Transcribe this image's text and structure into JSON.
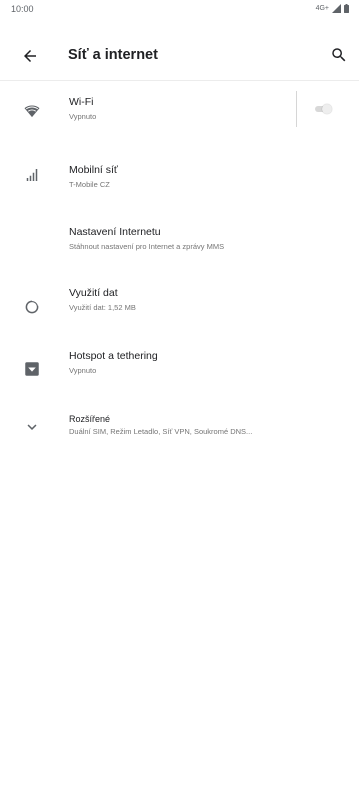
{
  "status_bar": {
    "time": "10:00",
    "network_label": "4G+",
    "icons": [
      "signal-icon",
      "battery-icon"
    ]
  },
  "app_bar": {
    "title": "Síť a internet",
    "back_icon": "arrow-back-icon",
    "search_icon": "search-icon"
  },
  "items": [
    {
      "key": "wifi",
      "title": "Wi-Fi",
      "subtitle": "Vypnuto",
      "icon": "wifi-icon",
      "has_toggle": true,
      "toggle_on": false
    },
    {
      "key": "mobile",
      "title": "Mobilní síť",
      "subtitle": "T-Mobile CZ",
      "icon": "cellular-signal-icon"
    },
    {
      "key": "internet-settings",
      "title": "Nastavení Internetu",
      "subtitle": "Stáhnout nastavení pro Internet a zprávy MMS",
      "icon": ""
    },
    {
      "key": "data-usage",
      "title": "Využití dat",
      "subtitle": "Využití dat: 1,52 MB",
      "icon": "data-usage-icon"
    },
    {
      "key": "hotspot",
      "title": "Hotspot a tethering",
      "subtitle": "Vypnuto",
      "icon": "hotspot-icon"
    },
    {
      "key": "advanced",
      "title": "Rozšířené",
      "subtitle": "Duální SIM, Režim Letadlo, Síť VPN, Soukromé DNS...",
      "icon": "chevron-down-icon"
    }
  ],
  "colors": {
    "text_primary": "#202124",
    "text_secondary": "#757575",
    "icon": "#5f6368",
    "divider": "#ececec"
  }
}
